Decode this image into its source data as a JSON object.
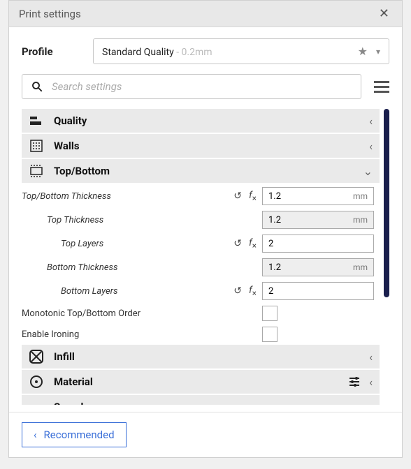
{
  "titlebar": {
    "title": "Print settings"
  },
  "profile": {
    "label": "Profile",
    "selected": "Standard Quality",
    "suffix": " - 0.2mm"
  },
  "search": {
    "placeholder": "Search settings"
  },
  "categories": {
    "quality": {
      "label": "Quality"
    },
    "walls": {
      "label": "Walls"
    },
    "topbottom": {
      "label": "Top/Bottom"
    },
    "infill": {
      "label": "Infill"
    },
    "material": {
      "label": "Material"
    },
    "speed": {
      "label": "Speed"
    }
  },
  "settings": {
    "top_bottom_thickness": {
      "label": "Top/Bottom Thickness",
      "value": "1.2",
      "unit": "mm"
    },
    "top_thickness": {
      "label": "Top Thickness",
      "value": "1.2",
      "unit": "mm"
    },
    "top_layers": {
      "label": "Top Layers",
      "value": "2"
    },
    "bottom_thickness": {
      "label": "Bottom Thickness",
      "value": "1.2",
      "unit": "mm"
    },
    "bottom_layers": {
      "label": "Bottom Layers",
      "value": "2"
    },
    "monotonic": {
      "label": "Monotonic Top/Bottom Order"
    },
    "enable_ironing": {
      "label": "Enable Ironing"
    }
  },
  "footer": {
    "recommended": "Recommended"
  }
}
